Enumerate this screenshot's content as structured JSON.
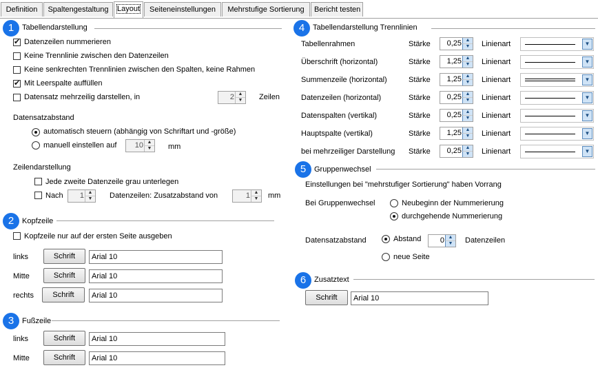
{
  "tabs": [
    "Definition",
    "Spaltengestaltung",
    "Layout",
    "Seiteneinstellungen",
    "Mehrstufige Sortierung",
    "Bericht testen"
  ],
  "active_tab": "Layout",
  "colors": {
    "badge": "#1a73e8",
    "spin_arrow": "#cfe3f6"
  },
  "sec1": {
    "num": "1",
    "title": "Tabellendarstellung",
    "opt_nummerieren": "Datenzeilen nummerieren",
    "opt_keine_trennlinie": "Keine Trennlinie zwischen den Datenzeilen",
    "opt_keine_senkrechten": "Keine senkrechten Trennlinien zwischen den Spalten, keine Rahmen",
    "opt_leerspalte": "Mit Leerspalte auffüllen",
    "opt_mehrzeilig": "Datensatz mehrzeilig darstellen, in",
    "mehrzeilig_value": "2",
    "mehrzeilig_unit": "Zeilen",
    "abstand_heading": "Datensatzabstand",
    "abstand_auto": "automatisch steuern (abhängig von Schriftart und -größe)",
    "abstand_manuell": "manuell einstellen auf",
    "abstand_value": "10",
    "abstand_unit": "mm",
    "zeilen_heading": "Zeilendarstellung",
    "zeilen_grau": "Jede zweite Datenzeile grau unterlegen",
    "zeilen_nach": "Nach",
    "zeilen_nach_value": "1",
    "zeilen_zusatz": "Datenzeilen: Zusatzabstand von",
    "zeilen_zusatz_value": "1",
    "zeilen_zusatz_unit": "mm"
  },
  "sec2": {
    "num": "2",
    "title": "Kopfzeile",
    "nur_erste": "Kopfzeile nur auf der ersten Seite ausgeben",
    "rows": [
      {
        "label": "links",
        "button": "Schrift",
        "font": "Arial 10"
      },
      {
        "label": "Mitte",
        "button": "Schrift",
        "font": "Arial 10"
      },
      {
        "label": "rechts",
        "button": "Schrift",
        "font": "Arial 10"
      }
    ]
  },
  "sec3": {
    "num": "3",
    "title": "Fußzeile",
    "rows": [
      {
        "label": "links",
        "button": "Schrift",
        "font": "Arial 10"
      },
      {
        "label": "Mitte",
        "button": "Schrift",
        "font": "Arial 10"
      }
    ]
  },
  "sec4": {
    "num": "4",
    "title": "Tabellendarstellung Trennlinien",
    "staerke_label": "Stärke",
    "linienart_label": "Linienart",
    "rows": [
      {
        "name": "Tabellenrahmen",
        "value": "0,25",
        "style": "single"
      },
      {
        "name": "Überschrift (horizontal)",
        "value": "1,25",
        "style": "single"
      },
      {
        "name": "Summenzeile (horizontal)",
        "value": "1,25",
        "style": "double"
      },
      {
        "name": "Datenzeilen (horizontal)",
        "value": "0,25",
        "style": "single"
      },
      {
        "name": "Datenspalten (vertikal)",
        "value": "0,25",
        "style": "single"
      },
      {
        "name": "Hauptspalte (vertikal)",
        "value": "1,25",
        "style": "single"
      },
      {
        "name": "bei mehrzeiliger Darstellung",
        "value": "0,25",
        "style": "single"
      }
    ]
  },
  "sec5": {
    "num": "5",
    "title": "Gruppenwechsel",
    "note": "Einstellungen bei \"mehrstufiger Sortierung\" haben Vorrang",
    "bei_label": "Bei Gruppenwechsel",
    "neubeginn": "Neubeginn der Nummerierung",
    "durchgehend": "durchgehende Nummerierung",
    "abstand_label": "Datensatzabstand",
    "abstand_opt": "Abstand",
    "abstand_value": "0",
    "abstand_unit": "Datenzeilen",
    "neue_seite": "neue Seite"
  },
  "sec6": {
    "num": "6",
    "title": "Zusatztext",
    "button": "Schrift",
    "font": "Arial 10"
  }
}
